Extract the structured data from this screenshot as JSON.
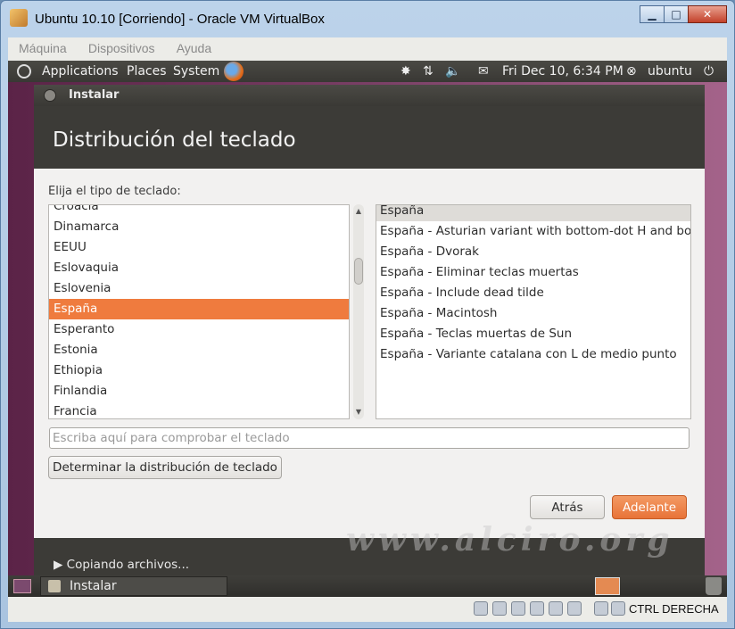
{
  "vbox": {
    "title": "Ubuntu 10.10 [Corriendo] - Oracle VM VirtualBox",
    "controls": {
      "minimize": "▁",
      "maximize": "□",
      "close": "✕"
    },
    "menu": [
      "Máquina",
      "Dispositivos",
      "Ayuda"
    ],
    "host_key": "CTRL DERECHA"
  },
  "gnome_top": {
    "applications": "Applications",
    "places": "Places",
    "system": "System",
    "clock": "Fri Dec 10,  6:34 PM",
    "user": "ubuntu",
    "tray": {
      "network": "⇅",
      "volume": "🔈",
      "mail": "✉",
      "power": "⏻",
      "bug": "✸",
      "user_switch": "⊗"
    }
  },
  "installer": {
    "window_title": "Instalar",
    "heading": "Distribución del teclado",
    "prompt": "Elija el tipo de teclado:",
    "layouts": [
      "Croacia",
      "Dinamarca",
      "EEUU",
      "Eslovaquia",
      "Eslovenia",
      "España",
      "Esperanto",
      "Estonia",
      "Ethiopia",
      "Finlandia",
      "Francia"
    ],
    "selected_layout": "España",
    "variants": [
      "España",
      "España - Asturian variant with bottom-dot H and bottom-dot L",
      "España - Dvorak",
      "España - Eliminar teclas muertas",
      "España - Include dead tilde",
      "España - Macintosh",
      "España - Teclas muertas de Sun",
      "España - Variante catalana con L de medio punto"
    ],
    "selected_variant": "España",
    "test_placeholder": "Escriba aquí para comprobar el teclado",
    "test_value": "",
    "detect_button": "Determinar la distribución de teclado",
    "back_button": "Atrás",
    "forward_button": "Adelante",
    "progress_toggle": "▶ Copiando archivos...",
    "watermark": "www.alciro.org",
    "scroll_up": "▲",
    "scroll_down": "▼"
  },
  "gnome_bottom": {
    "task_label": "Instalar"
  }
}
